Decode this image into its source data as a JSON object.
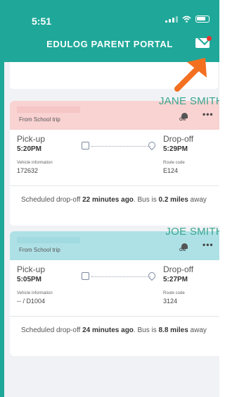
{
  "status_bar": {
    "time": "5:51"
  },
  "header": {
    "title": "EDULOG PARENT PORTAL"
  },
  "icons": {
    "mail": "mail-icon",
    "notification_dot": "notification-dot-icon",
    "bell": "bell-icon",
    "more": "more-icon",
    "bus": "bus-icon",
    "pin": "location-pin-icon"
  },
  "colors": {
    "brand": "#1fa899",
    "card1_header": "#f9d2d2",
    "card2_header": "#aee1e6",
    "name": "#39a68f",
    "arrow": "#f37021"
  },
  "trips": [
    {
      "student": "JANE SMITH",
      "trip_type": "From School trip",
      "bell_status": "ON",
      "more": "•••",
      "pickup_label": "Pick-up",
      "pickup_time": "5:20PM",
      "dropoff_label": "Drop-off",
      "dropoff_time": "5:29PM",
      "vehicle_label": "Vehicle information",
      "vehicle_value": "172632",
      "route_label": "Route code",
      "route_value": "E124",
      "note_prefix": "Scheduled drop-off ",
      "note_time": "22 minutes ago",
      "note_mid": ". Bus is ",
      "note_dist": "0.2 miles",
      "note_suffix": " away"
    },
    {
      "student": "JOE SMITH",
      "trip_type": "From School trip",
      "bell_status": "ON",
      "more": "•••",
      "pickup_label": "Pick-up",
      "pickup_time": "5:05PM",
      "dropoff_label": "Drop-off",
      "dropoff_time": "5:27PM",
      "vehicle_label": "Vehicle information",
      "vehicle_value": "-- / D1004",
      "route_label": "Route code",
      "route_value": "3124",
      "note_prefix": "Scheduled drop-off ",
      "note_time": "24 minutes ago",
      "note_mid": ". Bus is ",
      "note_dist": "8.8 miles",
      "note_suffix": " away"
    }
  ]
}
